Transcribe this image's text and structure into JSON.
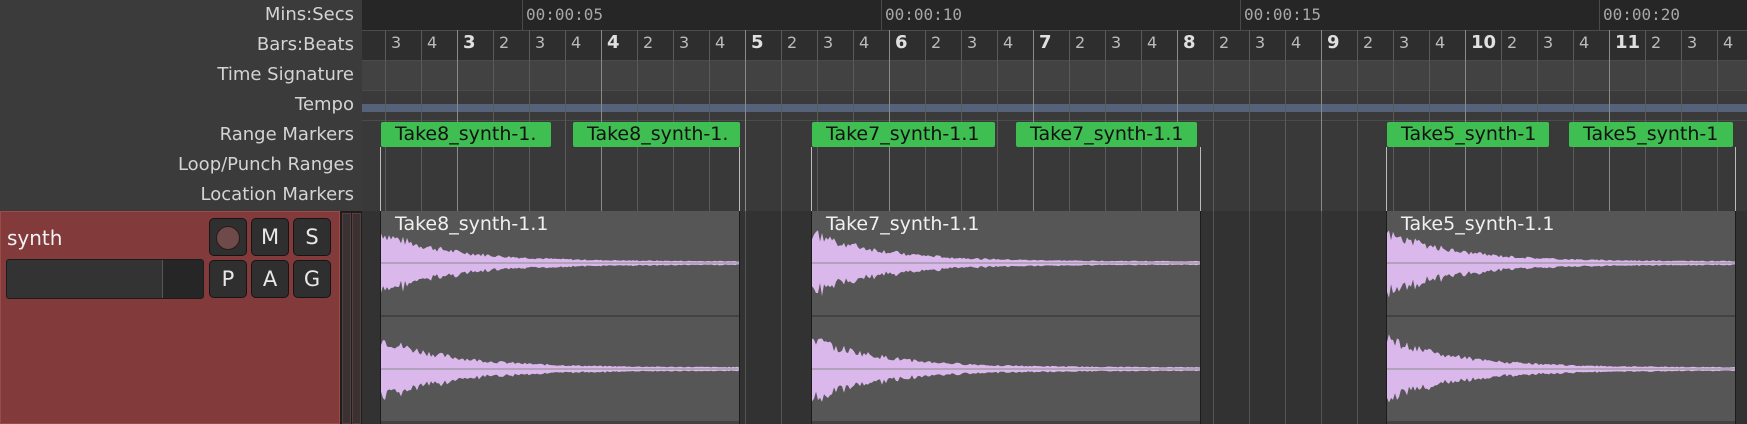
{
  "rulers": {
    "labels": [
      "Mins:Secs",
      "Bars:Beats",
      "Time Signature",
      "Tempo",
      "Range Markers",
      "Loop/Punch Ranges",
      "Location Markers"
    ]
  },
  "timecodes": [
    "00:00:05",
    "00:00:10",
    "00:00:15",
    "00:00:20"
  ],
  "bars": [
    "3",
    "4",
    "5",
    "6",
    "7",
    "8",
    "9",
    "10",
    "11"
  ],
  "beats": [
    "2",
    "3",
    "4"
  ],
  "range_markers": [
    "Take8_synth-1.",
    "Take8_synth-1.",
    "Take7_synth-1.1",
    "Take7_synth-1.1",
    "Take5_synth-1",
    "Take5_synth-1"
  ],
  "track": {
    "name": "synth",
    "buttons": [
      "M",
      "S",
      "P",
      "A",
      "G"
    ]
  },
  "regions": [
    "Take8_synth-1.1",
    "Take7_synth-1.1",
    "Take5_synth-1.1"
  ],
  "colors": {
    "range_marker": "#3fbf52",
    "track_header": "#823a3b",
    "waveform": "#dbb8ec",
    "tempo_line": "#55627a"
  }
}
